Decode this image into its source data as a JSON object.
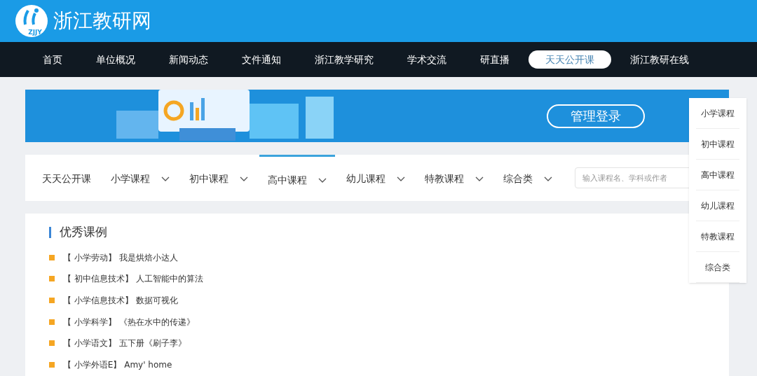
{
  "header": {
    "site_title": "浙江教研网",
    "logo_text": "ZJJY"
  },
  "nav": [
    {
      "label": "首页",
      "selected": false
    },
    {
      "label": "单位概况",
      "selected": false
    },
    {
      "label": "新闻动态",
      "selected": false
    },
    {
      "label": "文件通知",
      "selected": false
    },
    {
      "label": "浙江教学研究",
      "selected": false
    },
    {
      "label": "学术交流",
      "selected": false
    },
    {
      "label": "研直播",
      "selected": false
    },
    {
      "label": "天天公开课",
      "selected": true
    },
    {
      "label": "浙江教研在线",
      "selected": false
    }
  ],
  "banner": {
    "login_button": "管理登录"
  },
  "course_tabs": [
    {
      "label": "天天公开课",
      "selected": false,
      "dropdown": false
    },
    {
      "label": "小学课程",
      "selected": false,
      "dropdown": true
    },
    {
      "label": "初中课程",
      "selected": false,
      "dropdown": true
    },
    {
      "label": "高中课程",
      "selected": true,
      "dropdown": true
    },
    {
      "label": "幼儿课程",
      "selected": false,
      "dropdown": true
    },
    {
      "label": "特教课程",
      "selected": false,
      "dropdown": true
    },
    {
      "label": "综合类",
      "selected": false,
      "dropdown": true
    }
  ],
  "search": {
    "placeholder": "输入课程名、学科或作者"
  },
  "section": {
    "title": "优秀课例",
    "items": [
      "【 小学劳动】 我是烘焙小达人",
      "【 初中信息技术】 人工智能中的算法",
      "【 小学信息技术】 数据可视化",
      "【 小学科学】 《热在水中的传递》",
      "【 小学语文】 五下册《刷子李》",
      "【 小学外语E】 Amy' home"
    ]
  },
  "side_menu": [
    "小学课程",
    "初中课程",
    "高中课程",
    "幼儿课程",
    "特教课程",
    "综合类"
  ]
}
